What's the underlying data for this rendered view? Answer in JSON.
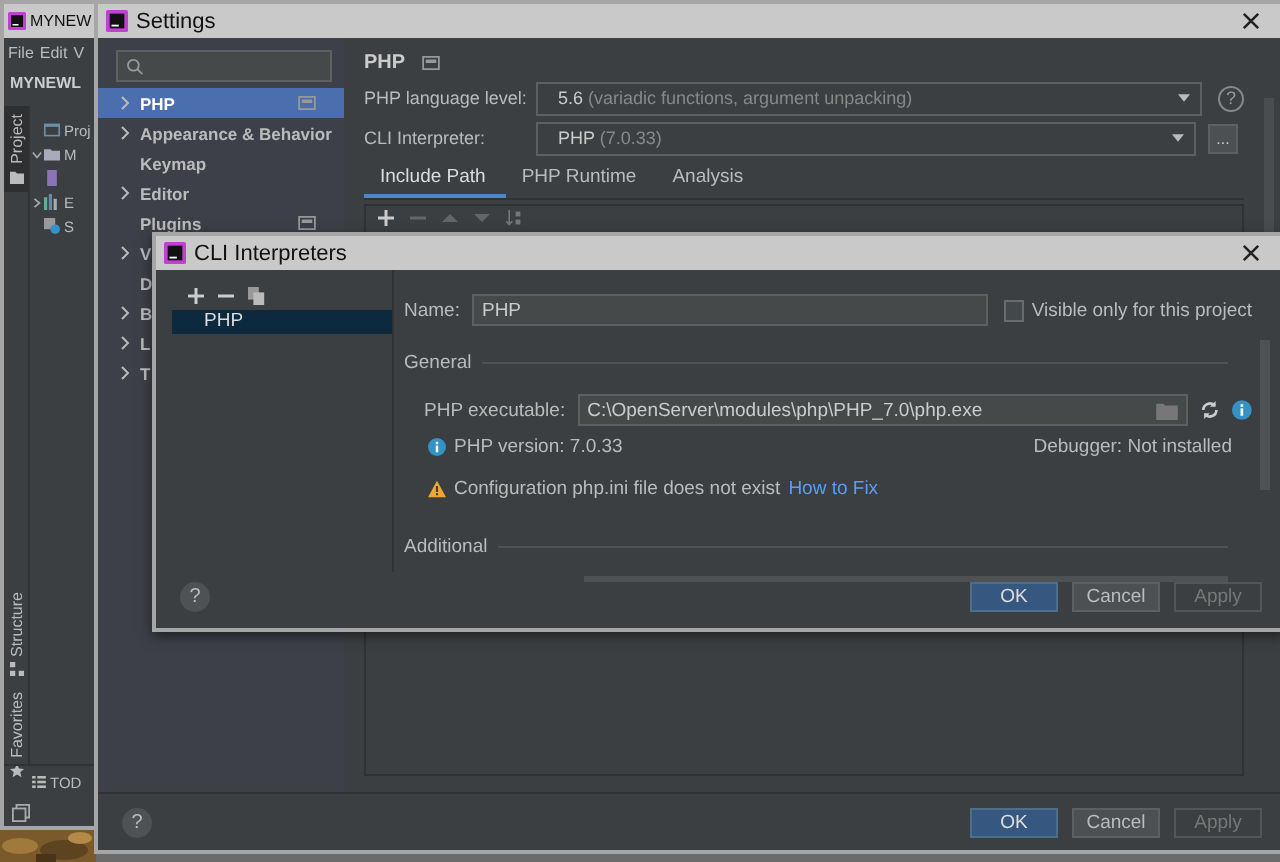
{
  "ide_window": {
    "title": "MYNEW",
    "menu": [
      "File",
      "Edit",
      "V"
    ],
    "project_title": "MYNEWL",
    "tool_tabs": [
      {
        "label": "Project",
        "selected": true,
        "kind": "project"
      },
      {
        "label": "Structure",
        "selected": false,
        "kind": "structure"
      },
      {
        "label": "Favorites",
        "selected": false,
        "kind": "favorites"
      }
    ],
    "tree": [
      {
        "label": "Proj",
        "kind": "module"
      },
      {
        "label": "M",
        "kind": "folder",
        "expanded": true
      },
      {
        "kind": "php"
      },
      {
        "label": "E",
        "kind": "library",
        "expanded": false
      },
      {
        "label": "S",
        "kind": "scratch"
      }
    ],
    "bottom_tab": "TOD"
  },
  "settings": {
    "title": "Settings",
    "nav": [
      {
        "label": "PHP",
        "selected": true,
        "expandable": true,
        "project": true
      },
      {
        "label": "Appearance & Behavior",
        "selected": false,
        "expandable": true,
        "project": false
      },
      {
        "label": "Keymap",
        "selected": false,
        "expandable": false,
        "project": false
      },
      {
        "label": "Editor",
        "selected": false,
        "expandable": true,
        "project": false
      },
      {
        "label": "Plugins",
        "selected": false,
        "expandable": false,
        "project": true
      },
      {
        "label": "V",
        "selected": false,
        "expandable": true,
        "project": false
      },
      {
        "label": "D",
        "selected": false,
        "expandable": false,
        "project": false
      },
      {
        "label": "B",
        "selected": false,
        "expandable": true,
        "project": false
      },
      {
        "label": "L",
        "selected": false,
        "expandable": true,
        "project": false
      },
      {
        "label": "T",
        "selected": false,
        "expandable": true,
        "project": false
      }
    ],
    "page_title": "PHP",
    "fields": [
      {
        "label": "PHP language level:",
        "value": "5.6",
        "hint": "(variadic functions, argument unpacking)",
        "kind": "help",
        "button": "?"
      },
      {
        "label": "CLI Interpreter:",
        "value": "PHP",
        "hint": "(7.0.33)",
        "kind": "browse",
        "button": "..."
      }
    ],
    "tabs": [
      {
        "label": "Include Path",
        "selected": true
      },
      {
        "label": "PHP Runtime",
        "selected": false
      },
      {
        "label": "Analysis",
        "selected": false
      }
    ],
    "help": "?",
    "buttons": [
      {
        "label": "OK",
        "kind": "primary",
        "disabled": false
      },
      {
        "label": "Cancel",
        "kind": "normal",
        "disabled": false
      },
      {
        "label": "Apply",
        "kind": "normal",
        "disabled": true
      }
    ]
  },
  "cli_dialog": {
    "title": "CLI Interpreters",
    "interpreters": [
      {
        "label": "PHP",
        "selected": true
      }
    ],
    "name_label": "Name:",
    "name_value": "PHP",
    "visible_only": {
      "label": "Visible only for this project",
      "checked": false
    },
    "general": "General",
    "executable_label": "PHP executable:",
    "executable_value": "C:\\OpenServer\\modules\\php\\PHP_7.0\\php.exe",
    "version": "PHP version: 7.0.33",
    "debugger": "Debugger: Not installed",
    "warning": "Configuration php.ini file does not exist",
    "fix_link": "How to Fix",
    "additional": "Additional",
    "help": "?",
    "buttons": [
      {
        "label": "OK",
        "kind": "primary",
        "disabled": false
      },
      {
        "label": "Cancel",
        "kind": "normal",
        "disabled": false
      },
      {
        "label": "Apply",
        "kind": "normal",
        "disabled": true
      }
    ]
  }
}
